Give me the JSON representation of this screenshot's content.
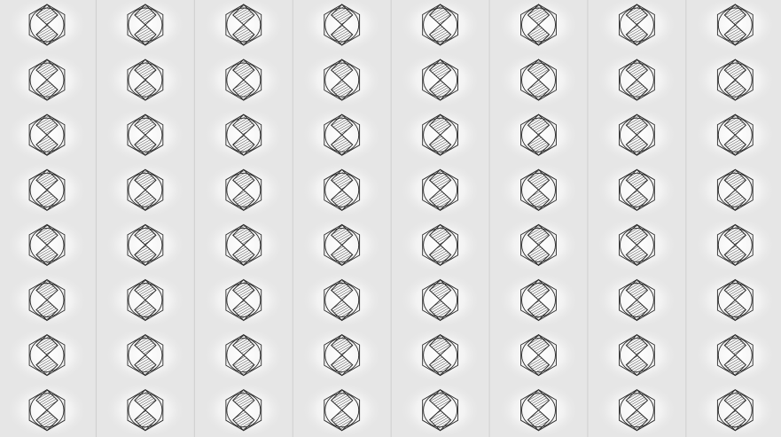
{
  "pattern": {
    "name": "tiled-hexagon-diamond-motif",
    "columns": 8,
    "rows": 8,
    "motif_icon": "hexagon-circle-diamond-icon",
    "colors": {
      "background": "#e6e6e6",
      "glow": "#ffffff",
      "stroke": "#2a2a2a",
      "hatch": "#3a3a3a",
      "column-divider": "#cfcfcf"
    }
  }
}
